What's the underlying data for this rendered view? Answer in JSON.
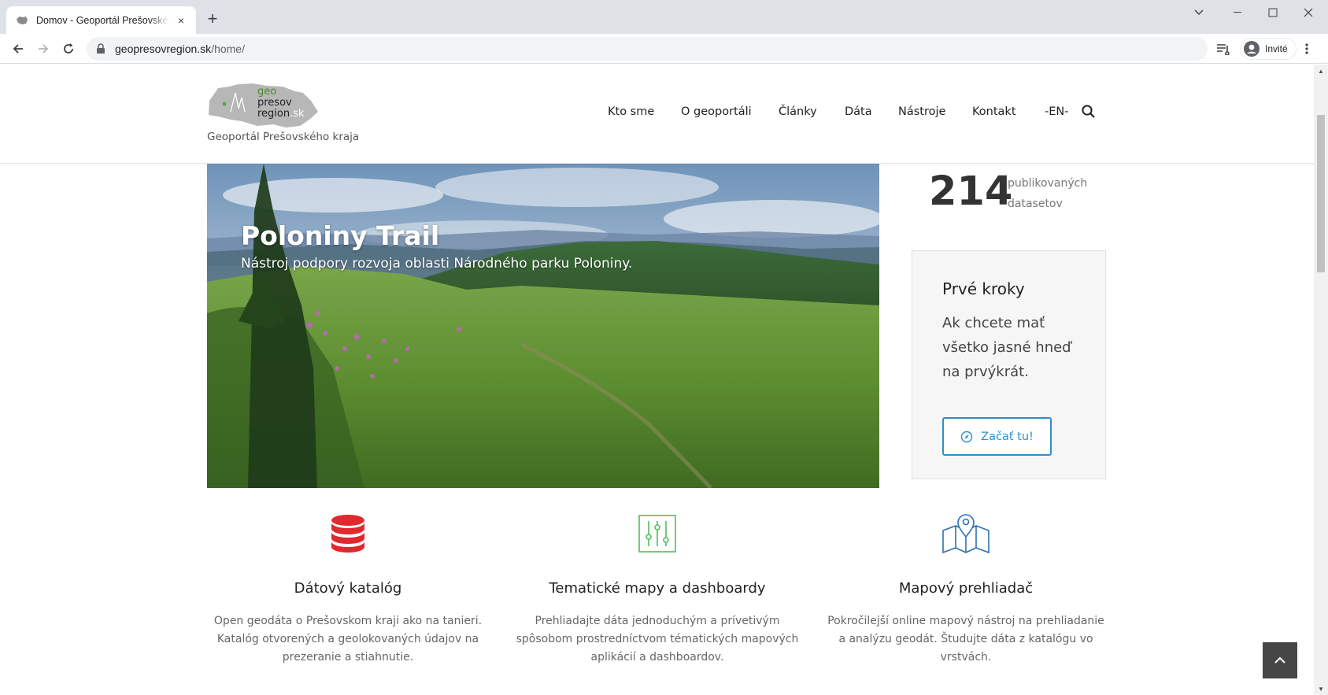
{
  "browser": {
    "tab_title": "Domov - Geoportál Prešovského",
    "tab_close": "×",
    "new_tab": "+",
    "url_host": "geopresovregion.sk",
    "url_path": "/home/",
    "profile_label": "Invité"
  },
  "header": {
    "logo_line1": "geo",
    "logo_line2": "presov",
    "logo_line3": "region",
    "logo_sk": ".sk",
    "tagline": "Geoportál Prešovského kraja",
    "nav": [
      "Kto sme",
      "O geoportáli",
      "Články",
      "Dáta",
      "Nástroje",
      "Kontakt",
      "-EN-"
    ]
  },
  "hero": {
    "title": "Poloniny Trail",
    "subtitle": "Nástroj podpory rozvoja oblasti Národného parku Poloniny."
  },
  "stats": {
    "count": "214",
    "label": "publikovaných datasetov"
  },
  "first_steps": {
    "title": "Prvé kroky",
    "text": "Ak chcete mať všetko jasné hneď na prvýkrát.",
    "button": "Začať tu!"
  },
  "features": [
    {
      "icon": "database-icon",
      "color": "#e0282e",
      "title": "Dátový katalóg",
      "text": "Open geodáta o Prešovskom kraji ako na tanieri. Katalóg otvorených a geolokovaných údajov na prezeranie a stiahnutie."
    },
    {
      "icon": "sliders-icon",
      "color": "#66c46a",
      "title": "Tematické mapy a dashboardy",
      "text": "Prehliadajte dáta jednoduchým a prívetivým spôsobom prostredníctvom tématických mapových aplikácií a dashboardov."
    },
    {
      "icon": "map-pin-icon",
      "color": "#2c6fb3",
      "title": "Mapový prehliadač",
      "text": "Pokročilejší online mapový nástroj na prehliadanie a analýzu geodát. Študujte dáta z katalógu vo vrstvách."
    }
  ],
  "colors": {
    "accent_blue": "#2f8fc7",
    "card_bg": "#f6f6f6",
    "totop_bg": "#464646"
  }
}
